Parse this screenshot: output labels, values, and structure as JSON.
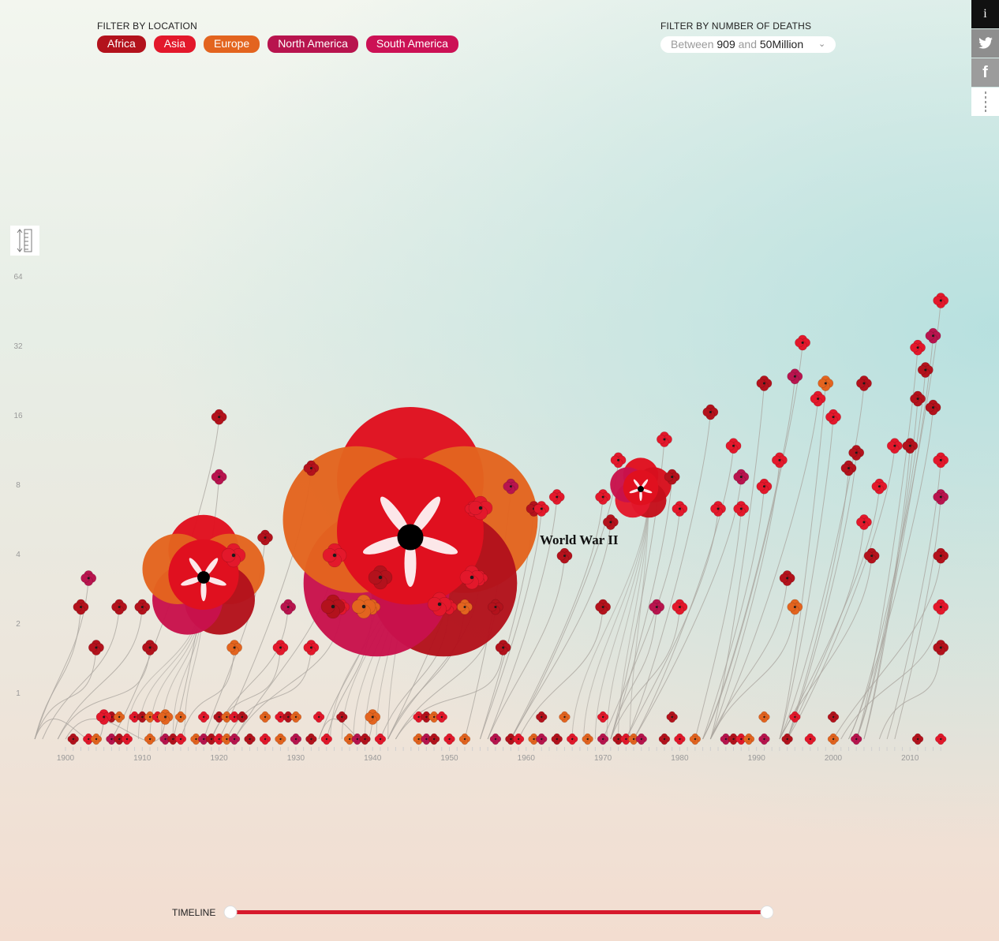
{
  "filters": {
    "location_label": "FILTER BY LOCATION",
    "locations": [
      {
        "label": "Africa",
        "color": "#b3121c"
      },
      {
        "label": "Asia",
        "color": "#e3182b"
      },
      {
        "label": "Europe",
        "color": "#e3641f"
      },
      {
        "label": "North America",
        "color": "#b8144e"
      },
      {
        "label": "South America",
        "color": "#cc1155"
      }
    ],
    "deaths_label": "FILTER BY NUMBER OF DEATHS",
    "deaths_between": "Between",
    "deaths_min": "909",
    "deaths_and": "and",
    "deaths_max": "50Million"
  },
  "share": {
    "info": "i",
    "twitter": "twitter-icon",
    "facebook": "f",
    "more": "more-icon"
  },
  "timeline": {
    "label": "TIMELINE",
    "start": 1900,
    "end": 2014,
    "accent": "#d7192b"
  },
  "chart_data": {
    "type": "scatter",
    "x_ticks": [
      "1900",
      "1910",
      "1920",
      "1930",
      "1940",
      "1950",
      "1960",
      "1970",
      "1980",
      "1990",
      "2000",
      "2010"
    ],
    "y_ticks": [
      "1",
      "2",
      "4",
      "8",
      "16",
      "32",
      "64"
    ],
    "y_scale": "log2",
    "xlim": [
      1900,
      2014
    ],
    "annotation": "World War II",
    "big_conflicts": [
      {
        "name": "World War II",
        "x": 1944.5,
        "y": 6.7
      },
      {
        "name": "",
        "x": 1918,
        "y": 4
      },
      {
        "name": "",
        "x": 1976,
        "y": 10
      }
    ],
    "points": [
      {
        "x": 1902,
        "y": 3,
        "r": "africa"
      },
      {
        "x": 1903,
        "y": 4,
        "r": "na"
      },
      {
        "x": 1904,
        "y": 2,
        "r": "africa"
      },
      {
        "x": 1905,
        "y": 1,
        "r": "asia"
      },
      {
        "x": 1907,
        "y": 3,
        "r": "africa"
      },
      {
        "x": 1910,
        "y": 3,
        "r": "africa"
      },
      {
        "x": 1911,
        "y": 2,
        "r": "africa"
      },
      {
        "x": 1913,
        "y": 1,
        "r": "europe"
      },
      {
        "x": 1920,
        "y": 20,
        "r": "africa"
      },
      {
        "x": 1920,
        "y": 11,
        "r": "na"
      },
      {
        "x": 1922,
        "y": 2,
        "r": "europe"
      },
      {
        "x": 1926,
        "y": 6,
        "r": "africa"
      },
      {
        "x": 1928,
        "y": 2,
        "r": "asia"
      },
      {
        "x": 1929,
        "y": 3,
        "r": "na"
      },
      {
        "x": 1932,
        "y": 2,
        "r": "asia"
      },
      {
        "x": 1932,
        "y": 12,
        "r": "africa"
      },
      {
        "x": 1935,
        "y": 5,
        "r": "asia"
      },
      {
        "x": 1936,
        "y": 3,
        "r": "asia"
      },
      {
        "x": 1940,
        "y": 3,
        "r": "europe"
      },
      {
        "x": 1940,
        "y": 1,
        "r": "europe"
      },
      {
        "x": 1941,
        "y": 4,
        "r": "asia"
      },
      {
        "x": 1950,
        "y": 3,
        "r": "asia"
      },
      {
        "x": 1952,
        "y": 3,
        "r": "europe"
      },
      {
        "x": 1953,
        "y": 8,
        "r": "asia"
      },
      {
        "x": 1954,
        "y": 4,
        "r": "asia"
      },
      {
        "x": 1956,
        "y": 3,
        "r": "africa"
      },
      {
        "x": 1957,
        "y": 2,
        "r": "africa"
      },
      {
        "x": 1958,
        "y": 10,
        "r": "na"
      },
      {
        "x": 1961,
        "y": 8,
        "r": "africa"
      },
      {
        "x": 1962,
        "y": 8,
        "r": "asia"
      },
      {
        "x": 1964,
        "y": 9,
        "r": "asia"
      },
      {
        "x": 1965,
        "y": 5,
        "r": "africa"
      },
      {
        "x": 1970,
        "y": 3,
        "r": "africa"
      },
      {
        "x": 1970,
        "y": 9,
        "r": "asia"
      },
      {
        "x": 1971,
        "y": 7,
        "r": "africa"
      },
      {
        "x": 1972,
        "y": 13,
        "r": "asia"
      },
      {
        "x": 1977,
        "y": 3,
        "r": "na"
      },
      {
        "x": 1978,
        "y": 16,
        "r": "asia"
      },
      {
        "x": 1979,
        "y": 11,
        "r": "africa"
      },
      {
        "x": 1980,
        "y": 3,
        "r": "asia"
      },
      {
        "x": 1980,
        "y": 8,
        "r": "asia"
      },
      {
        "x": 1984,
        "y": 21,
        "r": "africa"
      },
      {
        "x": 1985,
        "y": 8,
        "r": "asia"
      },
      {
        "x": 1987,
        "y": 15,
        "r": "asia"
      },
      {
        "x": 1988,
        "y": 11,
        "r": "na"
      },
      {
        "x": 1988,
        "y": 8,
        "r": "asia"
      },
      {
        "x": 1991,
        "y": 28,
        "r": "africa"
      },
      {
        "x": 1991,
        "y": 10,
        "r": "asia"
      },
      {
        "x": 1993,
        "y": 13,
        "r": "asia"
      },
      {
        "x": 1994,
        "y": 4,
        "r": "africa"
      },
      {
        "x": 1995,
        "y": 3,
        "r": "europe"
      },
      {
        "x": 1995,
        "y": 30,
        "r": "na"
      },
      {
        "x": 1996,
        "y": 42,
        "r": "asia"
      },
      {
        "x": 1998,
        "y": 24,
        "r": "asia"
      },
      {
        "x": 1999,
        "y": 28,
        "r": "europe"
      },
      {
        "x": 2000,
        "y": 20,
        "r": "asia"
      },
      {
        "x": 2002,
        "y": 12,
        "r": "africa"
      },
      {
        "x": 2003,
        "y": 14,
        "r": "africa"
      },
      {
        "x": 2004,
        "y": 7,
        "r": "asia"
      },
      {
        "x": 2004,
        "y": 28,
        "r": "africa"
      },
      {
        "x": 2005,
        "y": 5,
        "r": "africa"
      },
      {
        "x": 2006,
        "y": 10,
        "r": "asia"
      },
      {
        "x": 2008,
        "y": 15,
        "r": "asia"
      },
      {
        "x": 2010,
        "y": 15,
        "r": "africa"
      },
      {
        "x": 2011,
        "y": 24,
        "r": "africa"
      },
      {
        "x": 2011,
        "y": 40,
        "r": "asia"
      },
      {
        "x": 2012,
        "y": 32,
        "r": "africa"
      },
      {
        "x": 2013,
        "y": 45,
        "r": "na"
      },
      {
        "x": 2013,
        "y": 22,
        "r": "africa"
      },
      {
        "x": 2014,
        "y": 64,
        "r": "asia"
      },
      {
        "x": 2014,
        "y": 3,
        "r": "asia"
      },
      {
        "x": 2014,
        "y": 5,
        "r": "africa"
      },
      {
        "x": 2014,
        "y": 9,
        "r": "na"
      },
      {
        "x": 2014,
        "y": 13,
        "r": "asia"
      },
      {
        "x": 2014,
        "y": 2,
        "r": "africa"
      }
    ],
    "baseline_years": [
      1901,
      1903,
      1904,
      1906,
      1907,
      1908,
      1911,
      1913,
      1914,
      1915,
      1917,
      1918,
      1919,
      1920,
      1921,
      1922,
      1924,
      1926,
      1928,
      1930,
      1932,
      1934,
      1937,
      1938,
      1939,
      1941,
      1946,
      1947,
      1948,
      1950,
      1952,
      1956,
      1958,
      1959,
      1961,
      1962,
      1964,
      1966,
      1968,
      1970,
      1972,
      1973,
      1974,
      1975,
      1978,
      1980,
      1982,
      1986,
      1987,
      1988,
      1989,
      1991,
      1994,
      1997,
      2000,
      2003,
      2011,
      2014
    ],
    "ground_row_years": [
      1905,
      1906,
      1907,
      1909,
      1910,
      1911,
      1912,
      1913,
      1915,
      1918,
      1920,
      1921,
      1922,
      1923,
      1926,
      1928,
      1929,
      1930,
      1933,
      1936,
      1940,
      1946,
      1947,
      1948,
      1949,
      1962,
      1965,
      1970,
      1979,
      1991,
      1995,
      2000
    ]
  }
}
